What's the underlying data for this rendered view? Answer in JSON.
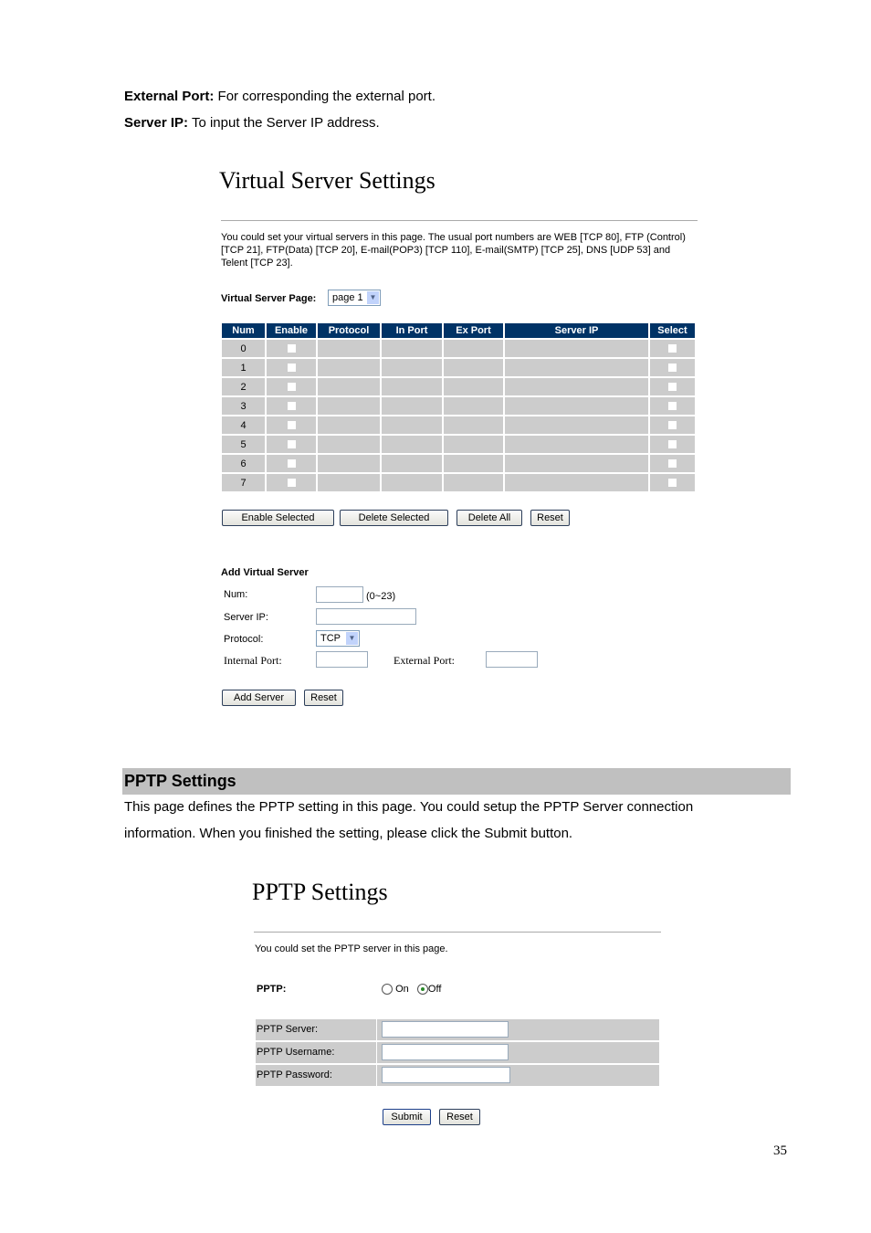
{
  "intro": [
    {
      "term": "External Port:",
      "text": " For corresponding the external port."
    },
    {
      "term": "Server IP:",
      "text": " To input the Server IP address."
    }
  ],
  "virtual_server": {
    "title": "Virtual Server Settings",
    "description": "You could set your virtual servers in this page. The usual port numbers are WEB [TCP 80], FTP (Control) [TCP 21], FTP(Data) [TCP 20], E-mail(POP3) [TCP 110], E-mail(SMTP) [TCP 25], DNS [UDP 53] and Telent [TCP 23].",
    "page_label": "Virtual Server Page:",
    "page_value": "page 1",
    "columns": [
      "Num",
      "Enable",
      "Protocol",
      "In Port",
      "Ex Port",
      "Server IP",
      "Select"
    ],
    "rows": [
      "0",
      "1",
      "2",
      "3",
      "4",
      "5",
      "6",
      "7"
    ],
    "buttons": {
      "enable_selected": "Enable Selected",
      "delete_selected": "Delete Selected",
      "delete_all": "Delete All",
      "reset": "Reset"
    },
    "add": {
      "heading": "Add Virtual Server",
      "num_label": "Num:",
      "num_hint": "(0~23)",
      "server_ip_label": "Server IP:",
      "protocol_label": "Protocol:",
      "protocol_value": "TCP",
      "internal_port_label": "Internal Port:",
      "external_port_label": "External Port:",
      "add_button": "Add Server",
      "reset_button": "Reset"
    }
  },
  "pptp_section": {
    "heading": "PPTP Settings",
    "body_line1": "This page defines the PPTP setting in this page. You could setup the PPTP Server connection",
    "body_line2": "information. When you finished the setting, please click the Submit button."
  },
  "pptp": {
    "title": "PPTP Settings",
    "description": "You could set the PPTP server in this page.",
    "pptp_label": "PPTP:",
    "on_label": "On",
    "off_label": "Off",
    "selected": "Off",
    "server_label": "PPTP Server:",
    "username_label": "PPTP Username:",
    "password_label": "PPTP Password:",
    "submit": "Submit",
    "reset": "Reset"
  },
  "page_number": "35",
  "colors": {
    "table_header": "#003366",
    "table_cell": "#cccccc",
    "section_bar": "#c0c0c0"
  }
}
